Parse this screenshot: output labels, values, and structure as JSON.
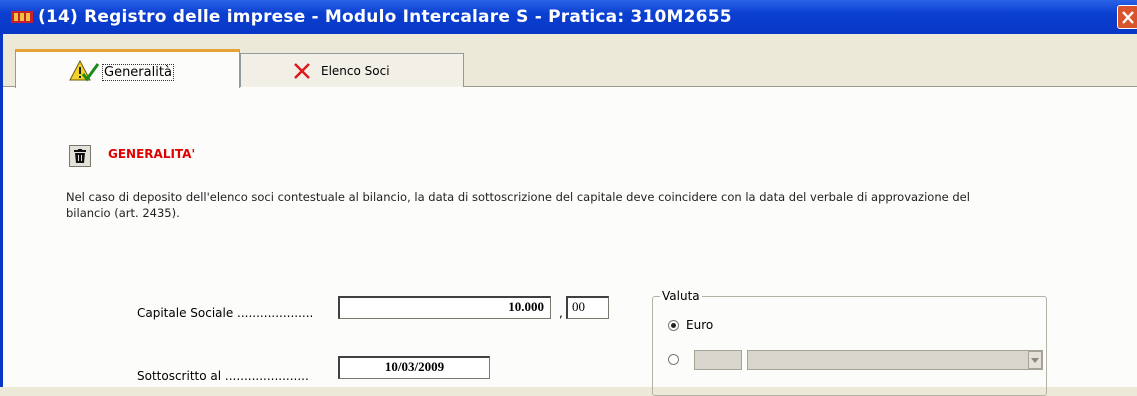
{
  "window": {
    "title": "(14) Registro delle imprese - Modulo Intercalare S - Pratica: 310M2655"
  },
  "tabs": [
    {
      "label": "Generalità",
      "icon": "warning-check-icon",
      "active": true
    },
    {
      "label": "Elenco Soci",
      "icon": "red-x-icon",
      "active": false
    }
  ],
  "section": {
    "title": "GENERALITA'",
    "icon": "trash-icon"
  },
  "info_text": "Nel caso di deposito dell'elenco soci contestuale al bilancio, la data di sottoscrizione del capitale deve coincidere con la data del verbale di approvazione del bilancio (art. 2435).",
  "form": {
    "capitale_label": "Capitale Sociale ....................",
    "capitale_value": "10.000",
    "capitale_decimals": "00",
    "comma": ",",
    "sottoscritto_label": "Sottoscritto al ......................",
    "sottoscritto_value": "10/03/2009"
  },
  "valuta": {
    "title": "Valuta",
    "option_euro": "Euro",
    "euro_selected": true,
    "other_selected": false
  },
  "colors": {
    "titlebar": "#0a3fd0",
    "accent_red": "#e00000",
    "tab_highlight": "#e7a23a"
  }
}
